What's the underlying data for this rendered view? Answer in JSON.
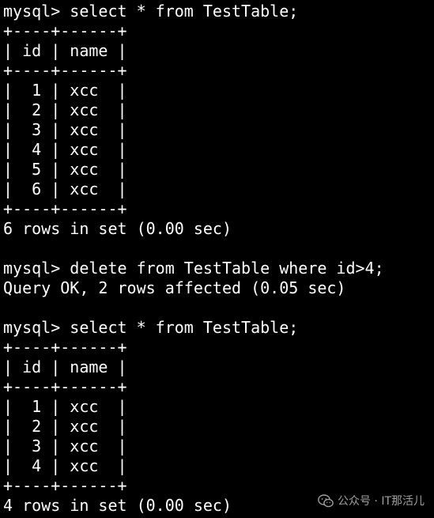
{
  "terminal": {
    "lines": [
      "mysql> select * from TestTable;",
      "+----+------+",
      "| id | name |",
      "+----+------+",
      "|  1 | xcc  |",
      "|  2 | xcc  |",
      "|  3 | xcc  |",
      "|  4 | xcc  |",
      "|  5 | xcc  |",
      "|  6 | xcc  |",
      "+----+------+",
      "6 rows in set (0.00 sec)",
      "",
      "mysql> delete from TestTable where id>4;",
      "Query OK, 2 rows affected (0.05 sec)",
      "",
      "mysql> select * from TestTable;",
      "+----+------+",
      "| id | name |",
      "+----+------+",
      "|  1 | xcc  |",
      "|  2 | xcc  |",
      "|  3 | xcc  |",
      "|  4 | xcc  |",
      "+----+------+",
      "4 rows in set (0.00 sec)"
    ]
  },
  "watermark": {
    "text": "公众号 · IT那活儿",
    "icon": "wechat-icon"
  },
  "colors": {
    "background": "#000000",
    "foreground": "#ffffff"
  }
}
